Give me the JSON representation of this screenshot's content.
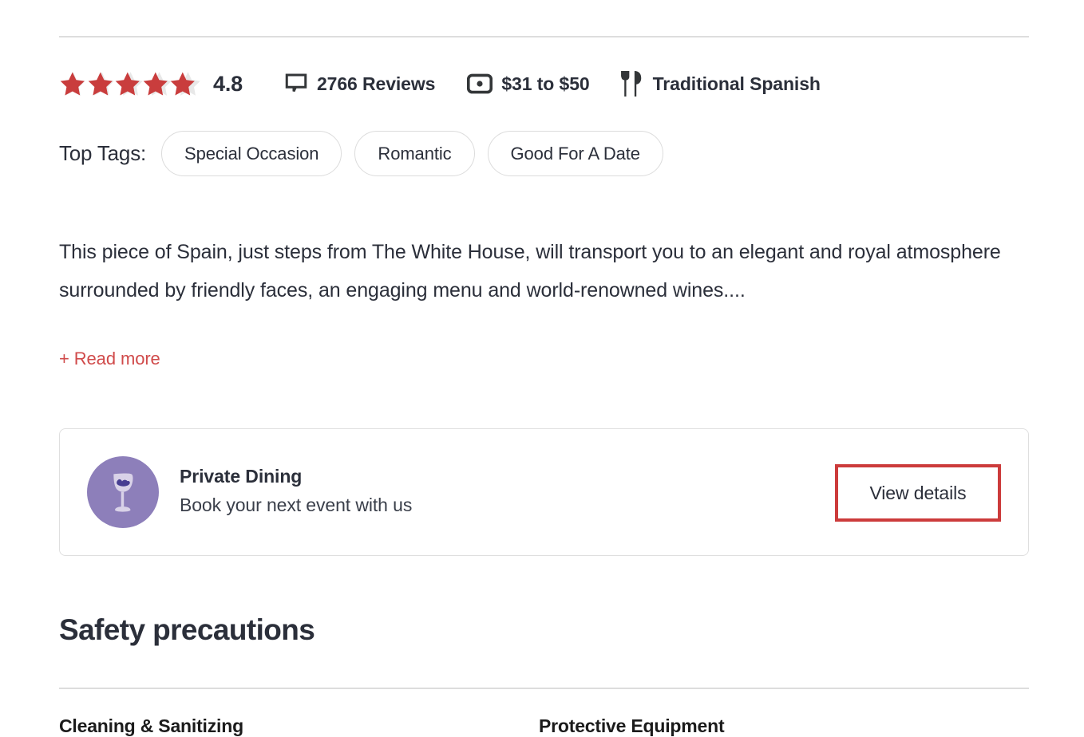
{
  "rating": {
    "stars_icon": "star-icon",
    "star_count": 5,
    "filled": 4.8,
    "value": "4.8",
    "star_color": "#c93d3d",
    "star_empty_color": "#e8e8e8"
  },
  "meta": [
    {
      "icon": "speech-bubble-icon",
      "label": "2766 Reviews"
    },
    {
      "icon": "banknote-icon",
      "label": "$31 to $50"
    },
    {
      "icon": "fork-knife-icon",
      "label": "Traditional Spanish"
    }
  ],
  "top_tags": {
    "label": "Top Tags:",
    "items": [
      "Special Occasion",
      "Romantic",
      "Good For A Date"
    ]
  },
  "description": {
    "text": "This piece of Spain, just steps from The White House, will transport you to an elegant and royal atmosphere surrounded by friendly faces, an engaging menu and world-renowned wines....",
    "read_more": "+ Read more",
    "read_more_color": "#d04a4a"
  },
  "private_dining": {
    "icon": "wine-glass-icon",
    "avatar_color": "#8d7fba",
    "title": "Private Dining",
    "subtitle": "Book your next event with us",
    "button_label": "View details",
    "button_highlight_color": "#cc3b3b"
  },
  "safety": {
    "heading": "Safety precautions",
    "columns": [
      "Cleaning & Sanitizing",
      "Protective Equipment"
    ]
  }
}
